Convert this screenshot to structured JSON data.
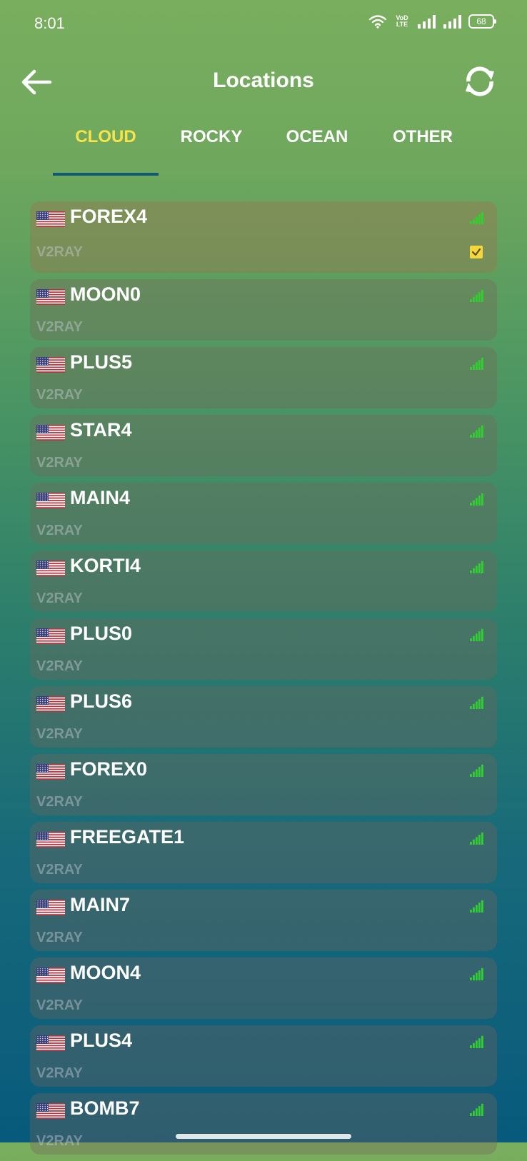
{
  "status_bar": {
    "time": "8:01",
    "volte_top": "VoD",
    "volte_bottom": "LTE",
    "battery": "68"
  },
  "header": {
    "title": "Locations",
    "back_icon": "arrow-left-icon",
    "refresh_icon": "refresh-icon"
  },
  "tabs": [
    {
      "label": "CLOUD",
      "active": true
    },
    {
      "label": "ROCKY",
      "active": false
    },
    {
      "label": "OCEAN",
      "active": false
    },
    {
      "label": "OTHER",
      "active": false
    }
  ],
  "colors": {
    "active_tab": "#f7e34a",
    "tab_indicator": "#0e5a73",
    "signal": "#2fd12f",
    "check": "#f3d73c"
  },
  "servers": [
    {
      "name": "FOREX4",
      "protocol": "V2RAY",
      "selected": true
    },
    {
      "name": "MOON0",
      "protocol": "V2RAY",
      "selected": false
    },
    {
      "name": "PLUS5",
      "protocol": "V2RAY",
      "selected": false
    },
    {
      "name": "STAR4",
      "protocol": "V2RAY",
      "selected": false
    },
    {
      "name": "MAIN4",
      "protocol": "V2RAY",
      "selected": false
    },
    {
      "name": "KORTI4",
      "protocol": "V2RAY",
      "selected": false
    },
    {
      "name": "PLUS0",
      "protocol": "V2RAY",
      "selected": false
    },
    {
      "name": "PLUS6",
      "protocol": "V2RAY",
      "selected": false
    },
    {
      "name": "FOREX0",
      "protocol": "V2RAY",
      "selected": false
    },
    {
      "name": "FREEGATE1",
      "protocol": "V2RAY",
      "selected": false
    },
    {
      "name": "MAIN7",
      "protocol": "V2RAY",
      "selected": false
    },
    {
      "name": "MOON4",
      "protocol": "V2RAY",
      "selected": false
    },
    {
      "name": "PLUS4",
      "protocol": "V2RAY",
      "selected": false
    },
    {
      "name": "BOMB7",
      "protocol": "V2RAY",
      "selected": false
    }
  ]
}
